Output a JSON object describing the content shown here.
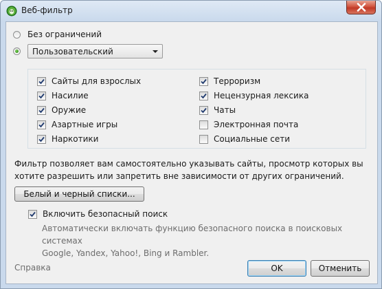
{
  "window": {
    "title": "Веб-фильтр",
    "close_icon": "close-icon"
  },
  "mode": {
    "options": [
      {
        "label": "Без ограничений",
        "selected": false
      },
      {
        "label": "",
        "selected": true
      }
    ],
    "profile_select": {
      "value": "Пользовательский"
    }
  },
  "categories": {
    "left": [
      {
        "label": "Сайты для взрослых",
        "checked": true
      },
      {
        "label": "Насилие",
        "checked": true
      },
      {
        "label": "Оружие",
        "checked": true
      },
      {
        "label": "Азартные игры",
        "checked": true
      },
      {
        "label": "Наркотики",
        "checked": true
      }
    ],
    "right": [
      {
        "label": "Терроризм",
        "checked": true
      },
      {
        "label": "Нецензурная лексика",
        "checked": true
      },
      {
        "label": "Чаты",
        "checked": true
      },
      {
        "label": "Электронная почта",
        "checked": false
      },
      {
        "label": "Социальные сети",
        "checked": false
      }
    ]
  },
  "lists": {
    "description_line1": "Фильтр позволяет вам самостоятельно указывать сайты, просмотр которых вы",
    "description_line2": "хотите разрешить или запретить вне зависимости от других ограничений.",
    "button_label": "Белый и черный списки..."
  },
  "safe_search": {
    "label": "Включить безопасный поиск",
    "checked": true,
    "description_line1": "Автоматически включать функцию безопасного поиска в поисковых системах",
    "description_line2": "Google, Yandex, Yahoo!, Bing и Rambler."
  },
  "footer": {
    "help_label": "Справка",
    "ok_label": "OK",
    "cancel_label": "Отменить"
  }
}
